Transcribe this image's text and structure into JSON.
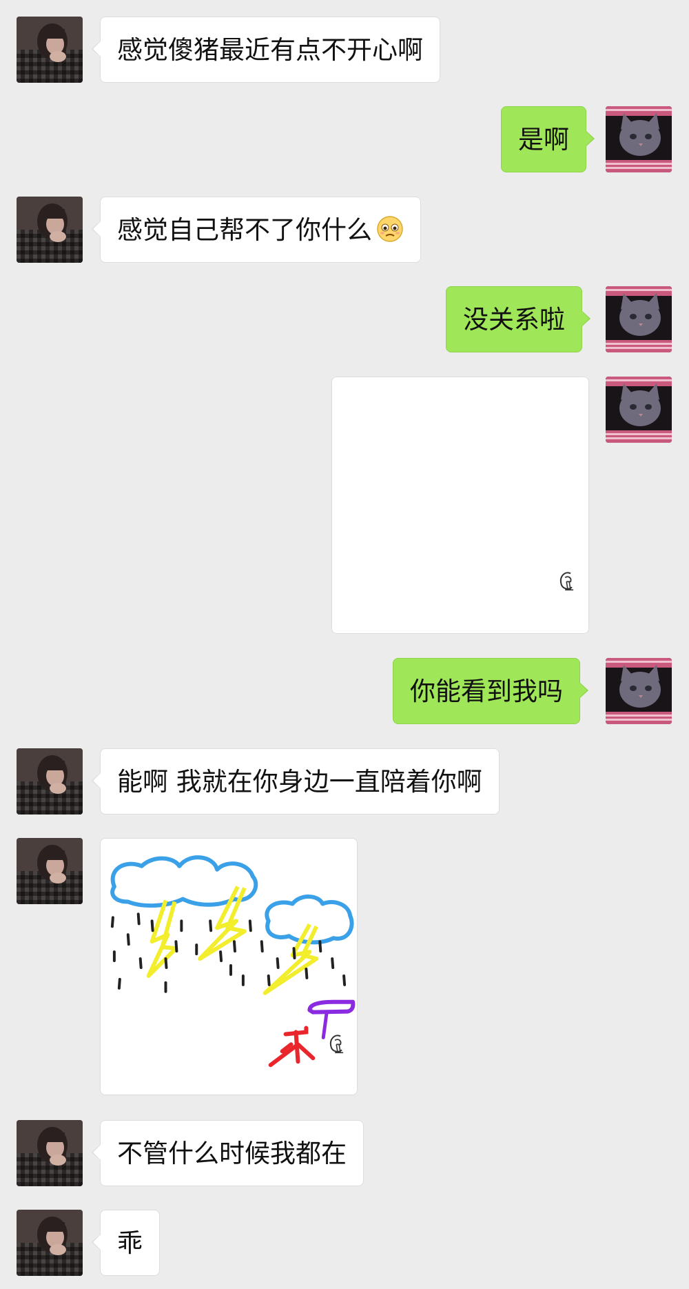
{
  "messages": [
    {
      "text": "感觉傻猪最近有点不开心啊"
    },
    {
      "text": "是啊"
    },
    {
      "text": "感觉自己帮不了你什么",
      "emoji": "worried-face-emoji"
    },
    {
      "text": "没关系啦"
    },
    {
      "type": "image",
      "content": "blank-drawing"
    },
    {
      "text": "你能看到我吗"
    },
    {
      "text": "能啊 我就在你身边一直陪着你啊"
    },
    {
      "type": "image",
      "content": "storm-drawing"
    },
    {
      "text": "不管什么时候我都在"
    },
    {
      "text": "乖"
    }
  ],
  "colors": {
    "background": "#ececec",
    "incoming_bubble": "#ffffff",
    "outgoing_bubble": "#9fe658"
  },
  "icons": {
    "incoming_avatar": "person-photo-avatar",
    "outgoing_avatar": "cat-photo-avatar",
    "drawing_watermark": "doodle-app-watermark-icon"
  }
}
